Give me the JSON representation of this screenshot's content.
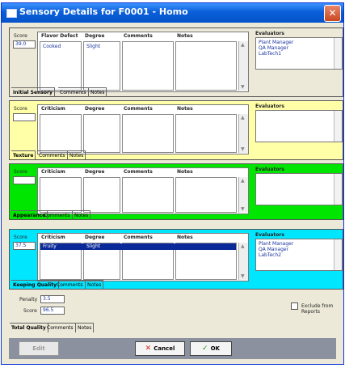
{
  "window": {
    "title": "Sensory Details for F0001 - Homo",
    "close_label": "✕"
  },
  "colors": {
    "initial": "#ece9d8",
    "texture": "#ffffa8",
    "appearance": "#00e600",
    "keeping": "#00e6ff",
    "value_text": "#1a35a0"
  },
  "initial": {
    "score_label": "Score",
    "score": "39.0",
    "headers": [
      "Flavor Defect",
      "Degree",
      "Comments",
      "Notes"
    ],
    "row": [
      "Cooked",
      "Slight"
    ],
    "evaluators_label": "Evaluators",
    "evaluators": [
      "Plant Manager",
      "QA Manager",
      "LabTech1"
    ],
    "tabs": [
      "Initial Sensory",
      "Comments",
      "Notes"
    ]
  },
  "texture": {
    "score_label": "Score",
    "score": "",
    "headers": [
      "Criticism",
      "Degree",
      "Comments",
      "Notes"
    ],
    "evaluators_label": "Evaluators",
    "evaluators": [],
    "tabs": [
      "Texture",
      "Comments",
      "Notes"
    ]
  },
  "appearance": {
    "score_label": "Score",
    "score": "",
    "headers": [
      "Criticism",
      "Degree",
      "Comments",
      "Notes"
    ],
    "evaluators_label": "Evaluators",
    "evaluators": [],
    "tabs": [
      "Appearance",
      "Comments",
      "Notes"
    ]
  },
  "keeping": {
    "score_label": "Score",
    "score": "37.5",
    "headers": [
      "Criticism",
      "Degree",
      "Comments",
      "Notes"
    ],
    "row": [
      "Fruity",
      "Slight"
    ],
    "evaluators_label": "Evaluators",
    "evaluators": [
      "Plant Manager",
      "QA Manager",
      "LabTech2"
    ],
    "tabs": [
      "Keeping Quality",
      "Comments",
      "Notes"
    ]
  },
  "totals": {
    "penalty_label": "Penalty",
    "penalty": "3.5",
    "score_label": "Score",
    "score": "96.5",
    "exclude_label": "Exclude from Reports",
    "tabs": [
      "Total Quality",
      "Comments",
      "Notes"
    ]
  },
  "buttons": {
    "edit": "Edit",
    "cancel": "Cancel",
    "ok": "OK"
  }
}
